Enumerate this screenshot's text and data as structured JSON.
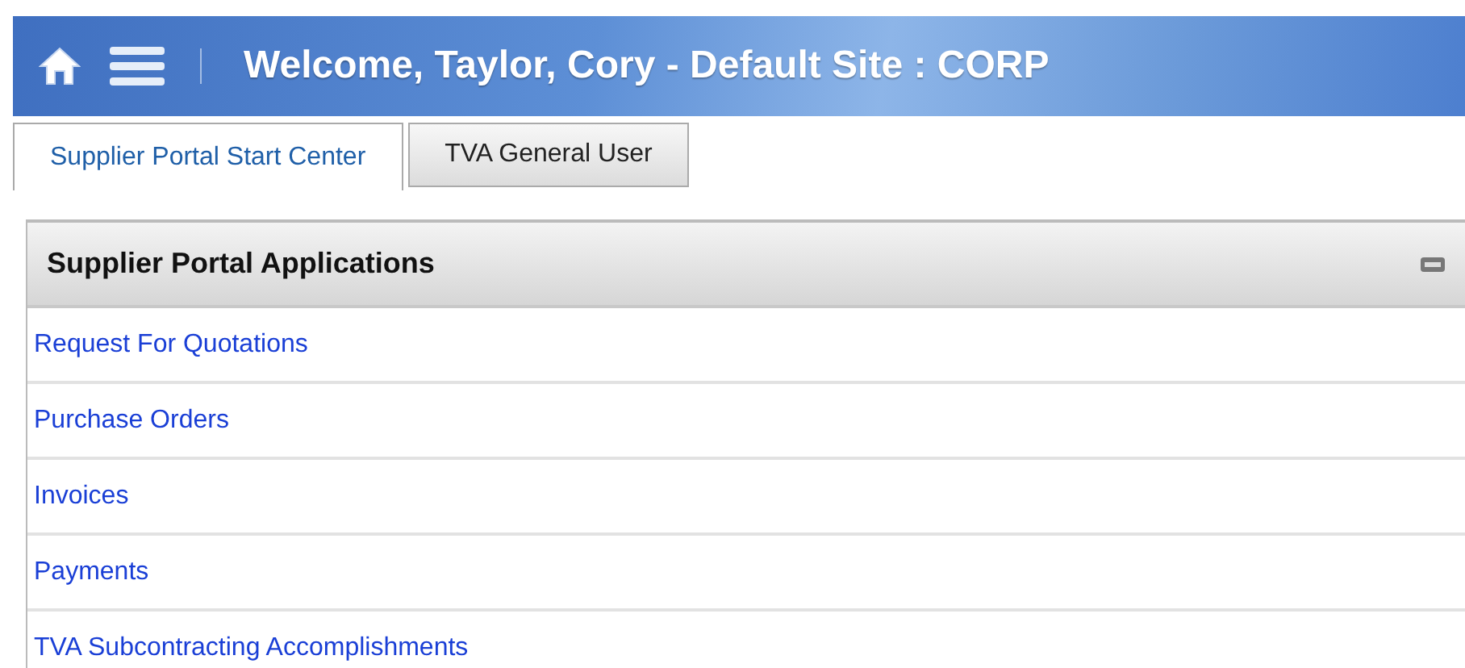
{
  "header": {
    "title": "Welcome, Taylor, Cory - Default Site : CORP"
  },
  "tabs": [
    {
      "label": "Supplier Portal Start Center",
      "selected": true
    },
    {
      "label": "TVA General User",
      "selected": false
    }
  ],
  "panel": {
    "title": "Supplier Portal Applications",
    "links": [
      "Request For Quotations",
      "Purchase Orders",
      "Invoices",
      "Payments",
      "TVA Subcontracting Accomplishments"
    ]
  }
}
